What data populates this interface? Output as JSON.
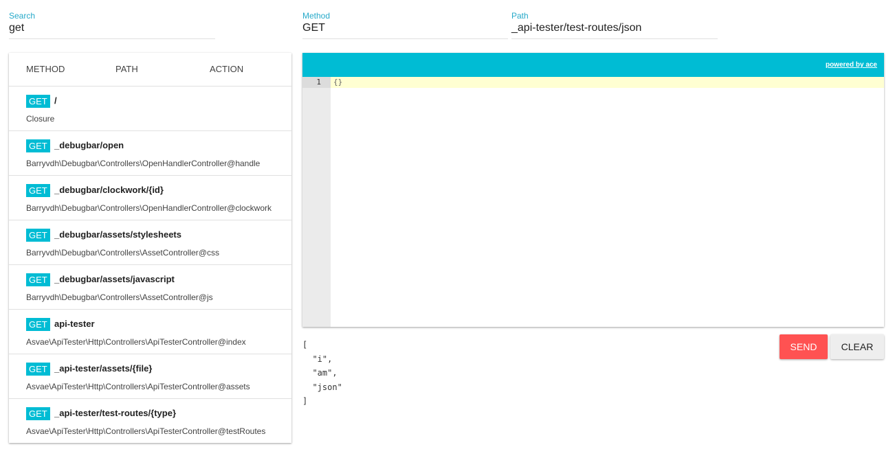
{
  "search": {
    "label": "Search",
    "value": "get"
  },
  "method_field": {
    "label": "Method",
    "value": "GET"
  },
  "path_field": {
    "label": "Path",
    "value": "_api-tester/test-routes/json"
  },
  "routes": {
    "headers": {
      "method": "METHOD",
      "path": "PATH",
      "action": "ACTION"
    },
    "rows": [
      {
        "method": "GET",
        "path": "/",
        "action": "Closure"
      },
      {
        "method": "GET",
        "path": "_debugbar/open",
        "action": "Barryvdh\\Debugbar\\Controllers\\OpenHandlerController@handle"
      },
      {
        "method": "GET",
        "path": "_debugbar/clockwork/{id}",
        "action": "Barryvdh\\Debugbar\\Controllers\\OpenHandlerController@clockwork"
      },
      {
        "method": "GET",
        "path": "_debugbar/assets/stylesheets",
        "action": "Barryvdh\\Debugbar\\Controllers\\AssetController@css"
      },
      {
        "method": "GET",
        "path": "_debugbar/assets/javascript",
        "action": "Barryvdh\\Debugbar\\Controllers\\AssetController@js"
      },
      {
        "method": "GET",
        "path": "api-tester",
        "action": "Asvae\\ApiTester\\Http\\Controllers\\ApiTesterController@index"
      },
      {
        "method": "GET",
        "path": "_api-tester/assets/{file}",
        "action": "Asvae\\ApiTester\\Http\\Controllers\\ApiTesterController@assets"
      },
      {
        "method": "GET",
        "path": "_api-tester/test-routes/{type}",
        "action": "Asvae\\ApiTester\\Http\\Controllers\\ApiTesterController@testRoutes"
      }
    ]
  },
  "editor": {
    "powered_by": "powered by ace",
    "line_number": "1",
    "content": "{}"
  },
  "response": {
    "text": "[\n  \"i\",\n  \"am\",\n  \"json\"\n]"
  },
  "buttons": {
    "send": "SEND",
    "clear": "CLEAR"
  },
  "colors": {
    "accent": "#00bcd4",
    "label": "#26a9c9",
    "send": "#ff5252",
    "clear": "#eeeeee"
  }
}
